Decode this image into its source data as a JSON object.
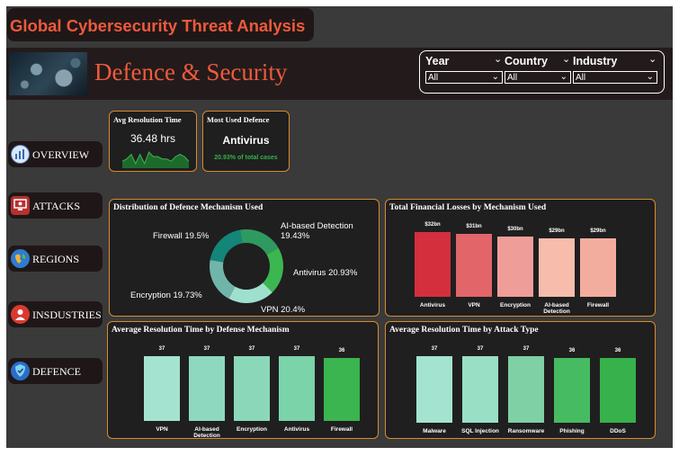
{
  "title": "Global Cybersecurity Threat Analysis",
  "section_title": "Defence & Security",
  "filters": [
    {
      "label": "Year",
      "value": "All"
    },
    {
      "label": "Country",
      "value": "All"
    },
    {
      "label": "Industry",
      "value": "All"
    }
  ],
  "nav": [
    {
      "label": "OVERVIEW",
      "icon": "overview-icon"
    },
    {
      "label": "ATTACKS",
      "icon": "attack-monitor-icon"
    },
    {
      "label": "REGIONS",
      "icon": "globe-icon"
    },
    {
      "label": "INSDUSTRIES",
      "icon": "factory-icon"
    },
    {
      "label": "DEFENCE",
      "icon": "shield-icon"
    }
  ],
  "kpi_resolution": {
    "title": "Avg Resolution Time",
    "value": "36.48 hrs"
  },
  "kpi_defence": {
    "title": "Most Used Defence",
    "value": "Antivirus",
    "sub": "20.93% of total cases"
  },
  "colors": {
    "accent": "#ee5a3c",
    "panel": "#1f1f1f",
    "border": "#d88a2f",
    "positive": "#33b24a"
  },
  "chart_data": [
    {
      "type": "line",
      "title": "",
      "values": [
        3,
        4,
        6,
        2,
        6,
        2,
        7,
        5,
        5,
        4,
        4,
        3,
        5,
        6,
        5,
        3
      ]
    },
    {
      "type": "pie",
      "title": "Distribution of Defence Mechanism Used",
      "categories": [
        "Antivirus",
        "VPN",
        "Encryption",
        "Firewall",
        "AI-based Detection"
      ],
      "values": [
        20.93,
        20.4,
        19.73,
        19.5,
        19.43
      ],
      "labels": [
        "Antivirus 20.93%",
        "VPN 20.4%",
        "Encryption 19.73%",
        "Firewall 19.5%",
        "AI-based Detection 19.43%"
      ],
      "colors": [
        "#3cb650",
        "#9ee0cd",
        "#71b5aa",
        "#148579",
        "#2f9a60"
      ]
    },
    {
      "type": "bar",
      "title": "Total Financial Losses by Mechanism Used",
      "categories": [
        "Antivirus",
        "VPN",
        "Encryption",
        "AI-based Detection",
        "Firewall"
      ],
      "values": [
        32,
        31,
        30,
        29,
        29
      ],
      "value_labels": [
        "$32bn",
        "$31bn",
        "$30bn",
        "$29bn",
        "$29bn"
      ],
      "ylim": [
        0,
        32
      ],
      "colors": [
        "#d42f3d",
        "#e2656a",
        "#ef9d98",
        "#f7bcab",
        "#f3ad9f"
      ]
    },
    {
      "type": "bar",
      "title": "Average Resolution Time by Defense Mechanism",
      "categories": [
        "VPN",
        "AI-based Detection",
        "Encryption",
        "Antivirus",
        "Firewall"
      ],
      "values": [
        37,
        37,
        37,
        37,
        36
      ],
      "value_labels": [
        "37",
        "37",
        "37",
        "37",
        "36"
      ],
      "ylim": [
        0,
        37
      ],
      "colors": [
        "#a3e3d0",
        "#8ed8bf",
        "#8ad8b9",
        "#7bd3aa",
        "#3ab54f"
      ]
    },
    {
      "type": "bar",
      "title": "Average Resolution Time by Attack Type",
      "categories": [
        "Malware",
        "SQL Injection",
        "Ransomware",
        "Phishing",
        "DDoS"
      ],
      "values": [
        37,
        37,
        37,
        36,
        36
      ],
      "value_labels": [
        "37",
        "37",
        "37",
        "36",
        "36"
      ],
      "ylim": [
        0,
        37
      ],
      "colors": [
        "#a3e3d0",
        "#99dfc6",
        "#7fd0a4",
        "#47bb61",
        "#36b14c"
      ]
    }
  ]
}
